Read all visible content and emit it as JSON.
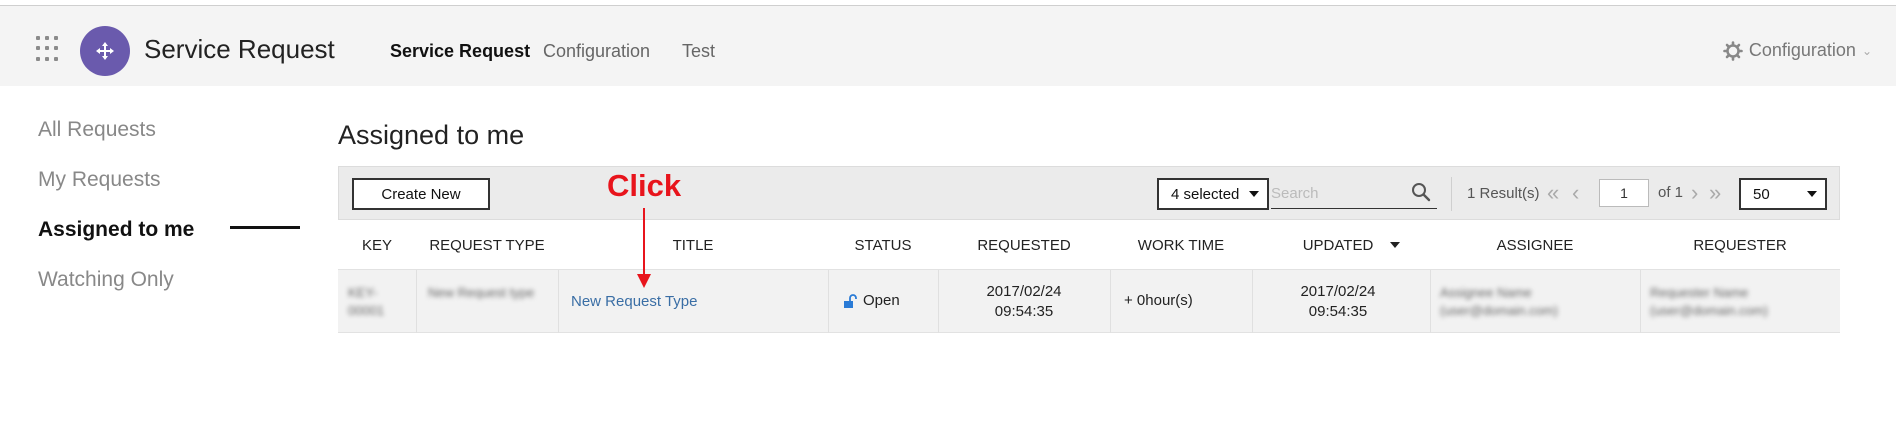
{
  "header": {
    "app_title": "Service Request",
    "nav": [
      "Service Request",
      "Configuration",
      "Test"
    ],
    "config_label": "Configuration",
    "logo_color": "#6a5aad"
  },
  "sidebar": {
    "items": [
      {
        "label": "All Requests",
        "active": false
      },
      {
        "label": "My Requests",
        "active": false
      },
      {
        "label": "Assigned to me",
        "active": true
      },
      {
        "label": "Watching Only",
        "active": false
      }
    ]
  },
  "main": {
    "title": "Assigned to me",
    "toolbar": {
      "create_label": "Create New",
      "filter_label": "4 selected",
      "search_placeholder": "Search",
      "results_text": "1 Result(s)",
      "page_value": "1",
      "of_text": "of 1",
      "page_size": "50"
    },
    "table": {
      "columns": [
        "KEY",
        "REQUEST TYPE",
        "TITLE",
        "STATUS",
        "REQUESTED",
        "WORK TIME",
        "UPDATED",
        "ASSIGNEE",
        "REQUESTER"
      ],
      "rows": [
        {
          "key": "KEY-00001",
          "request_type": "New Request type",
          "title": "New Request Type",
          "status": "Open",
          "requested_date": "2017/02/24",
          "requested_time": "09:54:35",
          "work_time": "+ 0hour(s)",
          "updated_date": "2017/02/24",
          "updated_time": "09:54:35",
          "assignee": "Assignee Name (user@domain.com)",
          "requester": "Requester Name (user@domain.com)"
        }
      ]
    }
  },
  "annotation": {
    "label": "Click",
    "color": "#e8141c"
  }
}
